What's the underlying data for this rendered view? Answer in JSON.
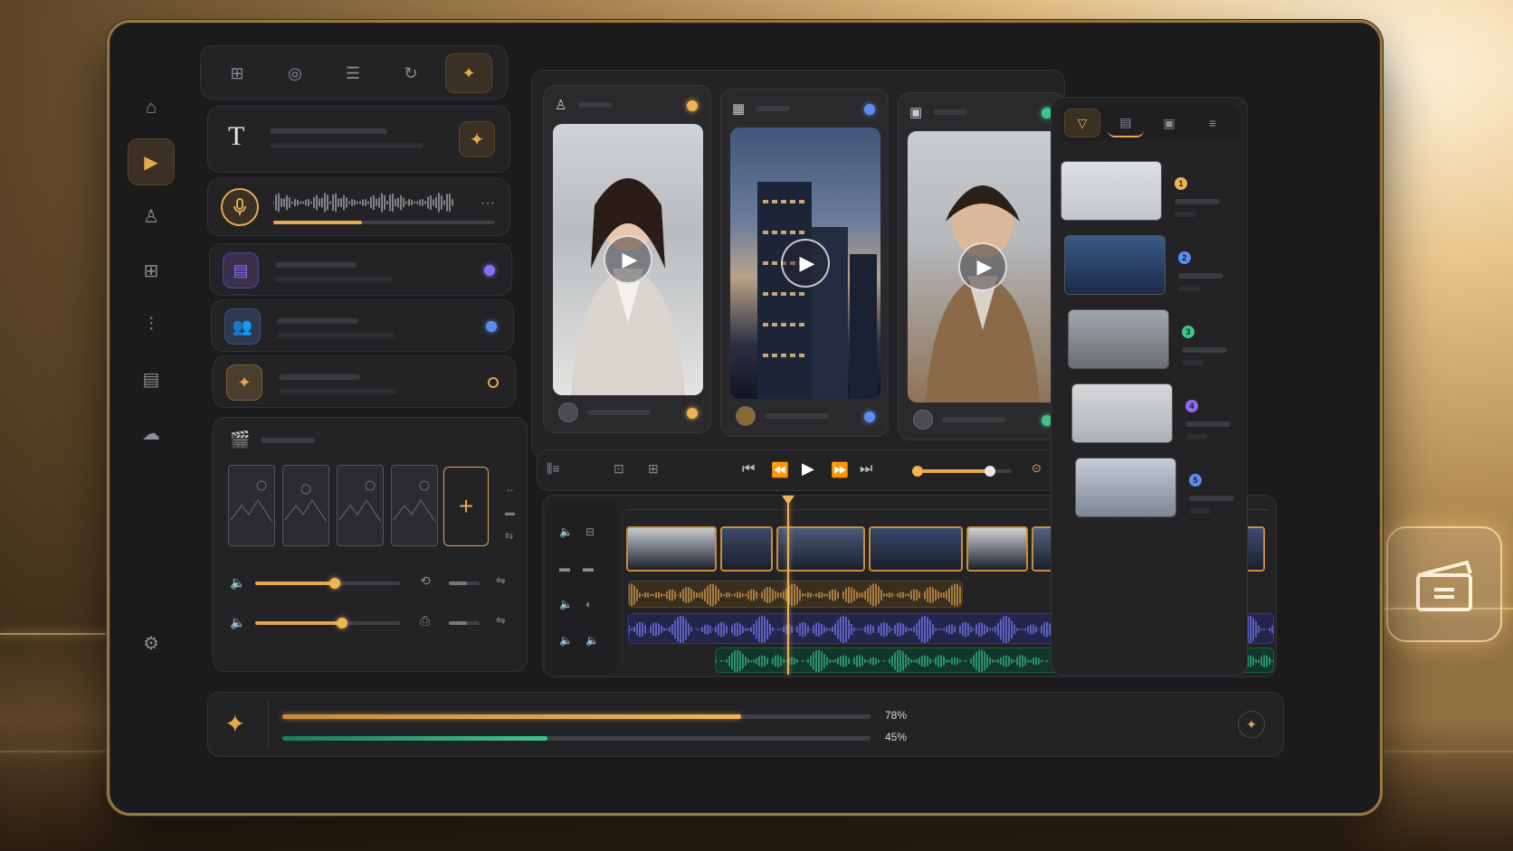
{
  "sidebar": {
    "items": [
      {
        "icon": "home-icon",
        "glyph": "⌂",
        "active": false
      },
      {
        "icon": "play-square-icon",
        "glyph": "▶",
        "active": true
      },
      {
        "icon": "user-icon",
        "glyph": "♙",
        "active": false
      },
      {
        "icon": "layout-icon",
        "glyph": "⊞",
        "active": false
      },
      {
        "icon": "audio-wave-icon",
        "glyph": "⫶",
        "active": false
      },
      {
        "icon": "document-icon",
        "glyph": "▤",
        "active": false
      },
      {
        "icon": "cloud-upload-icon",
        "glyph": "☁",
        "active": false
      }
    ],
    "settings_icon": "⚙"
  },
  "top_tabs": [
    {
      "icon": "grid-icon",
      "glyph": "⊞"
    },
    {
      "icon": "lightbulb-icon",
      "glyph": "◎"
    },
    {
      "icon": "list-icon",
      "glyph": "☰"
    },
    {
      "icon": "refresh-icon",
      "glyph": "↻"
    },
    {
      "icon": "sparkle-icon",
      "glyph": "✦"
    }
  ],
  "text_block": {
    "glyph": "T",
    "sparkle": "✦"
  },
  "voice_row": {
    "mic": "🎙",
    "more": "···",
    "progress": 0.4
  },
  "rows": [
    {
      "icon": "document-icon",
      "glyph": "▤",
      "color": "#8b6cf6",
      "dot": "#8b6cf6"
    },
    {
      "icon": "users-icon",
      "glyph": "👥",
      "color": "#5b8cf0",
      "dot": "#5b8cf0"
    },
    {
      "icon": "sparkle-icon",
      "glyph": "✦",
      "color": "#e3a94f",
      "dot": "#e3a94f"
    }
  ],
  "scene_panel": {
    "icon": "clapperboard-icon",
    "add": "+"
  },
  "audio": {
    "slider1": 0.55,
    "slider2": 0.6
  },
  "video_cards": [
    {
      "icon": "user-icon",
      "glyph": "♙",
      "dot": "#f0b457",
      "footer_dot": "#f0b457"
    },
    {
      "icon": "building-icon",
      "glyph": "▦",
      "dot": "#5b8cf0",
      "footer_dot": "#5b8cf0"
    },
    {
      "icon": "briefcase-icon",
      "glyph": "▣",
      "dot": "#3fc48a",
      "footer_dot": "#3fc48a"
    }
  ],
  "transport": {
    "rewind": "⏮",
    "back": "⏪",
    "play": "▶",
    "forward": "⏩",
    "end": "⏭",
    "scrub": 0.78
  },
  "timeline": {
    "playhead": 0.25
  },
  "right_tabs": [
    "filter-icon",
    "save-icon",
    "media-icon",
    "menu-icon"
  ],
  "queue": [
    {
      "num": "1",
      "color": "#f0b457"
    },
    {
      "num": "2",
      "color": "#5b8cf0"
    },
    {
      "num": "3",
      "color": "#3fc48a"
    },
    {
      "num": "4",
      "color": "#8b6cf6"
    },
    {
      "num": "5",
      "color": "#5b8cf0"
    }
  ],
  "progress": {
    "bar1_value": 0.78,
    "bar1_label": "78%",
    "bar2_value": 0.45,
    "bar2_label": "45%"
  },
  "floating_icon": "clapperboard-icon"
}
